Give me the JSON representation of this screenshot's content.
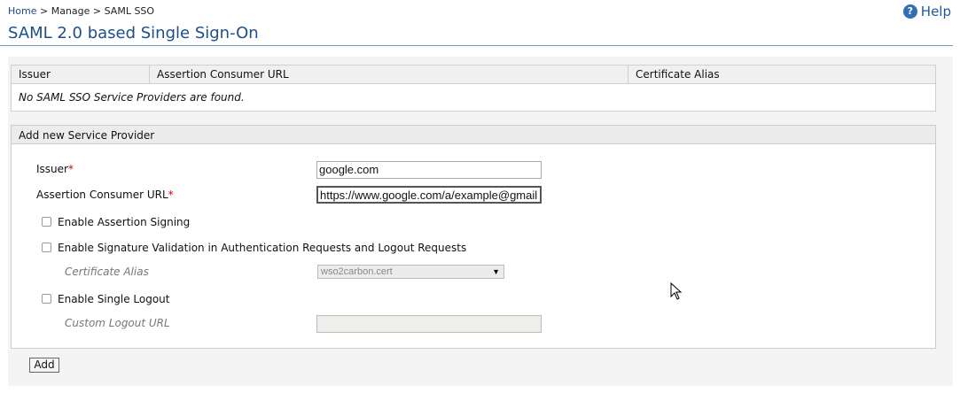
{
  "breadcrumb": {
    "home": "Home",
    "sep1": " > ",
    "manage": "Manage",
    "sep2": " > ",
    "current": "SAML SSO"
  },
  "help": {
    "icon": "?",
    "label": "Help"
  },
  "page": {
    "title": "SAML 2.0 based Single Sign-On"
  },
  "sp_table": {
    "columns": [
      "Issuer",
      "Assertion Consumer URL",
      "Certificate Alias"
    ],
    "empty_message": "No SAML SSO Service Providers are found."
  },
  "form": {
    "header": "Add new Service Provider",
    "issuer_label": "Issuer",
    "issuer_value": "google.com",
    "acs_label": "Assertion Consumer URL",
    "acs_value": "https://www.google.com/a/example@gmail",
    "required_marker": "*",
    "enable_assertion_signing": "Enable Assertion Signing",
    "enable_signature_validation": "Enable Signature Validation in Authentication Requests and Logout Requests",
    "certificate_alias_label": "Certificate Alias",
    "certificate_alias_value": "wso2carbon.cert",
    "enable_single_logout": "Enable Single Logout",
    "custom_logout_url_label": "Custom Logout URL",
    "custom_logout_url_value": "",
    "add_button": "Add"
  },
  "icons": {
    "help": "help-circle-icon",
    "select_arrow": "chevron-down-icon",
    "cursor": "mouse-pointer-icon"
  },
  "colors": {
    "title": "#1c4f8a",
    "link": "#1a4a8a",
    "required": "#d40000",
    "help": "#2f6fb5"
  }
}
